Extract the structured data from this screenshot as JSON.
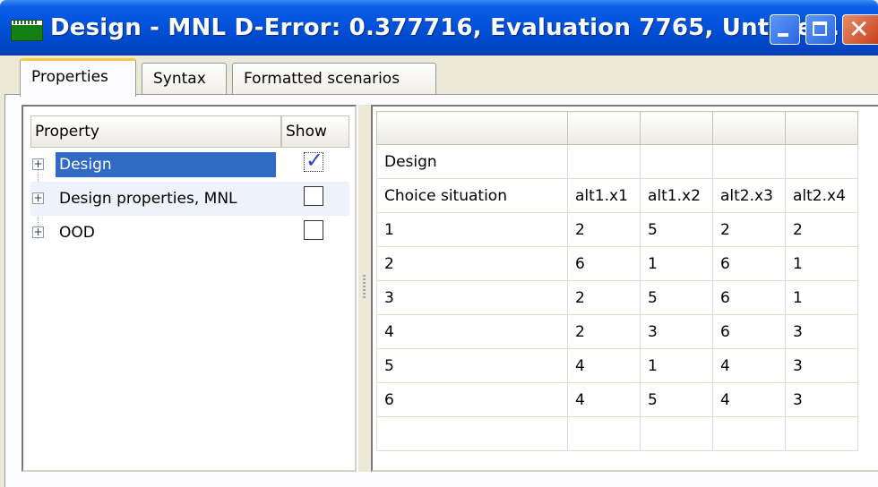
{
  "window": {
    "title": "Design  - MNL D-Error: 0.377716,  Evaluation 7765,  Untitle...",
    "close_glyph": "✕"
  },
  "tabs": [
    {
      "label": "Properties",
      "active": true
    },
    {
      "label": "Syntax",
      "active": false
    },
    {
      "label": "Formatted scenarios",
      "active": false
    }
  ],
  "properties_tree": {
    "columns": {
      "property": "Property",
      "show": "Show"
    },
    "items": [
      {
        "label": "Design",
        "expander": "+",
        "show": true,
        "selected": true
      },
      {
        "label": "Design properties, MNL",
        "expander": "+",
        "show": false
      },
      {
        "label": "OOD",
        "expander": "+",
        "show": false
      }
    ],
    "check_mark": "✓"
  },
  "design_grid": {
    "section_label": "Design",
    "header_row": [
      "Choice situation",
      "alt1.x1",
      "alt1.x2",
      "alt2.x3",
      "alt2.x4"
    ],
    "rows": [
      [
        "1",
        "2",
        "5",
        "2",
        "2"
      ],
      [
        "2",
        "6",
        "1",
        "6",
        "1"
      ],
      [
        "3",
        "2",
        "5",
        "6",
        "1"
      ],
      [
        "4",
        "2",
        "3",
        "6",
        "3"
      ],
      [
        "5",
        "4",
        "1",
        "4",
        "3"
      ],
      [
        "6",
        "4",
        "5",
        "4",
        "3"
      ]
    ]
  },
  "colors": {
    "titlebar": "#0150d8",
    "selection": "#316ac5",
    "active_tab_accent": "#ffc83c"
  }
}
